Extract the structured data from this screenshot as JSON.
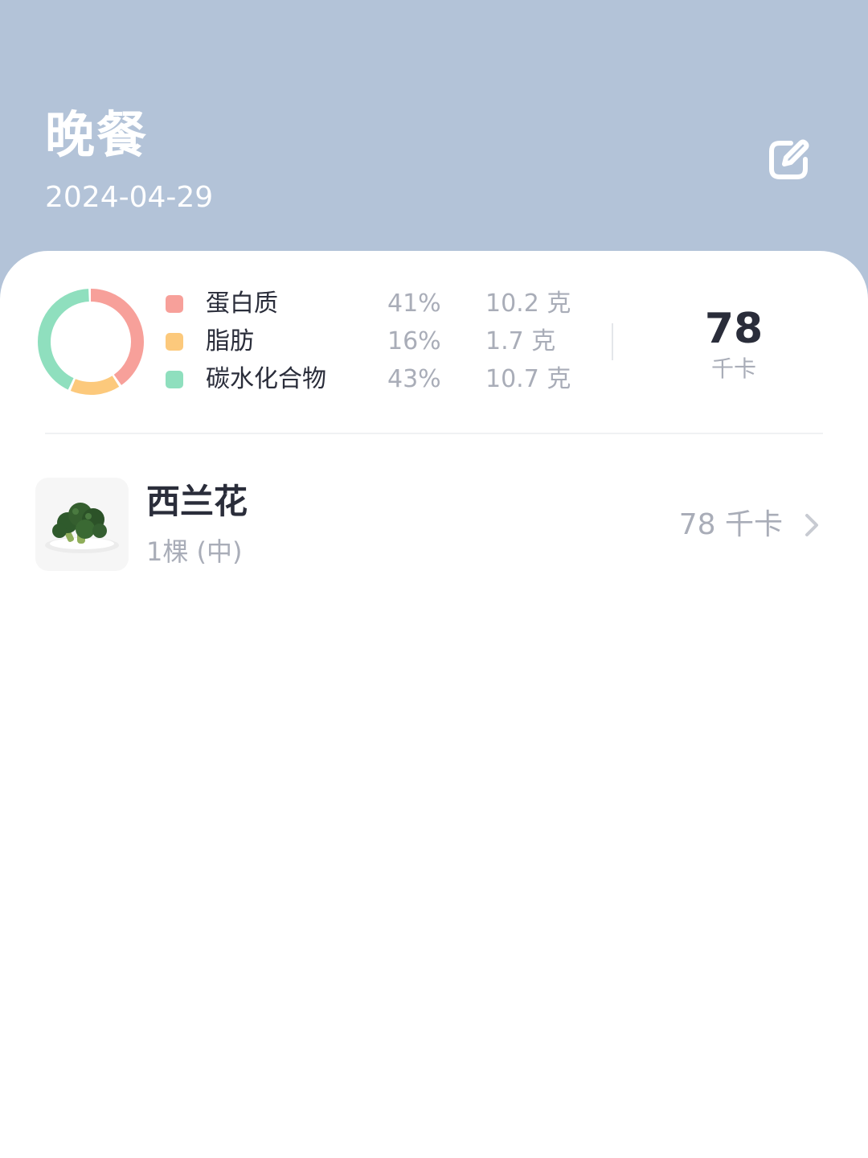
{
  "header": {
    "title": "晚餐",
    "date": "2024-04-29",
    "edit_icon": "edit-icon"
  },
  "summary": {
    "macros": [
      {
        "name": "蛋白质",
        "percent": "41%",
        "grams": "10.2 克",
        "color": "#f7a09a",
        "share": 0.41
      },
      {
        "name": "脂肪",
        "percent": "16%",
        "grams": "1.7 克",
        "color": "#fcc97c",
        "share": 0.16
      },
      {
        "name": "碳水化合物",
        "percent": "43%",
        "grams": "10.7 克",
        "color": "#8fdfbe",
        "share": 0.43
      }
    ],
    "total_kcal": "78",
    "total_unit": "千卡"
  },
  "foods": [
    {
      "name": "西兰花",
      "portion": "1棵 (中)",
      "kcal": "78 千卡",
      "icon": "chevron-right-icon"
    }
  ],
  "colors": {
    "header_bg": "#b3c3d8",
    "card_bg": "#ffffff",
    "text_primary": "#2a2d3a",
    "text_secondary": "#a9adb8"
  }
}
